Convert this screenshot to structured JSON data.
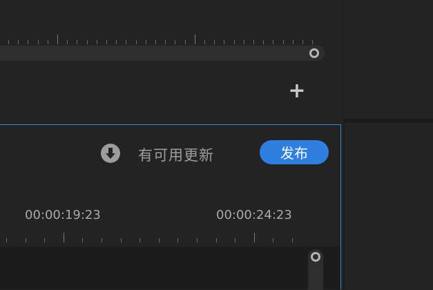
{
  "top_panel": {
    "add_icon": "plus-icon",
    "add_label": "+"
  },
  "update_bar": {
    "icon": "download-circle-icon",
    "message": "有可用更新",
    "publish_label": "发布",
    "accent": "#2f7fe0"
  },
  "timeline": {
    "timecodes": [
      "00:00:19:23",
      "00:00:24:23"
    ]
  },
  "colors": {
    "background": "#232323",
    "focus_border": "#3b84d6"
  }
}
